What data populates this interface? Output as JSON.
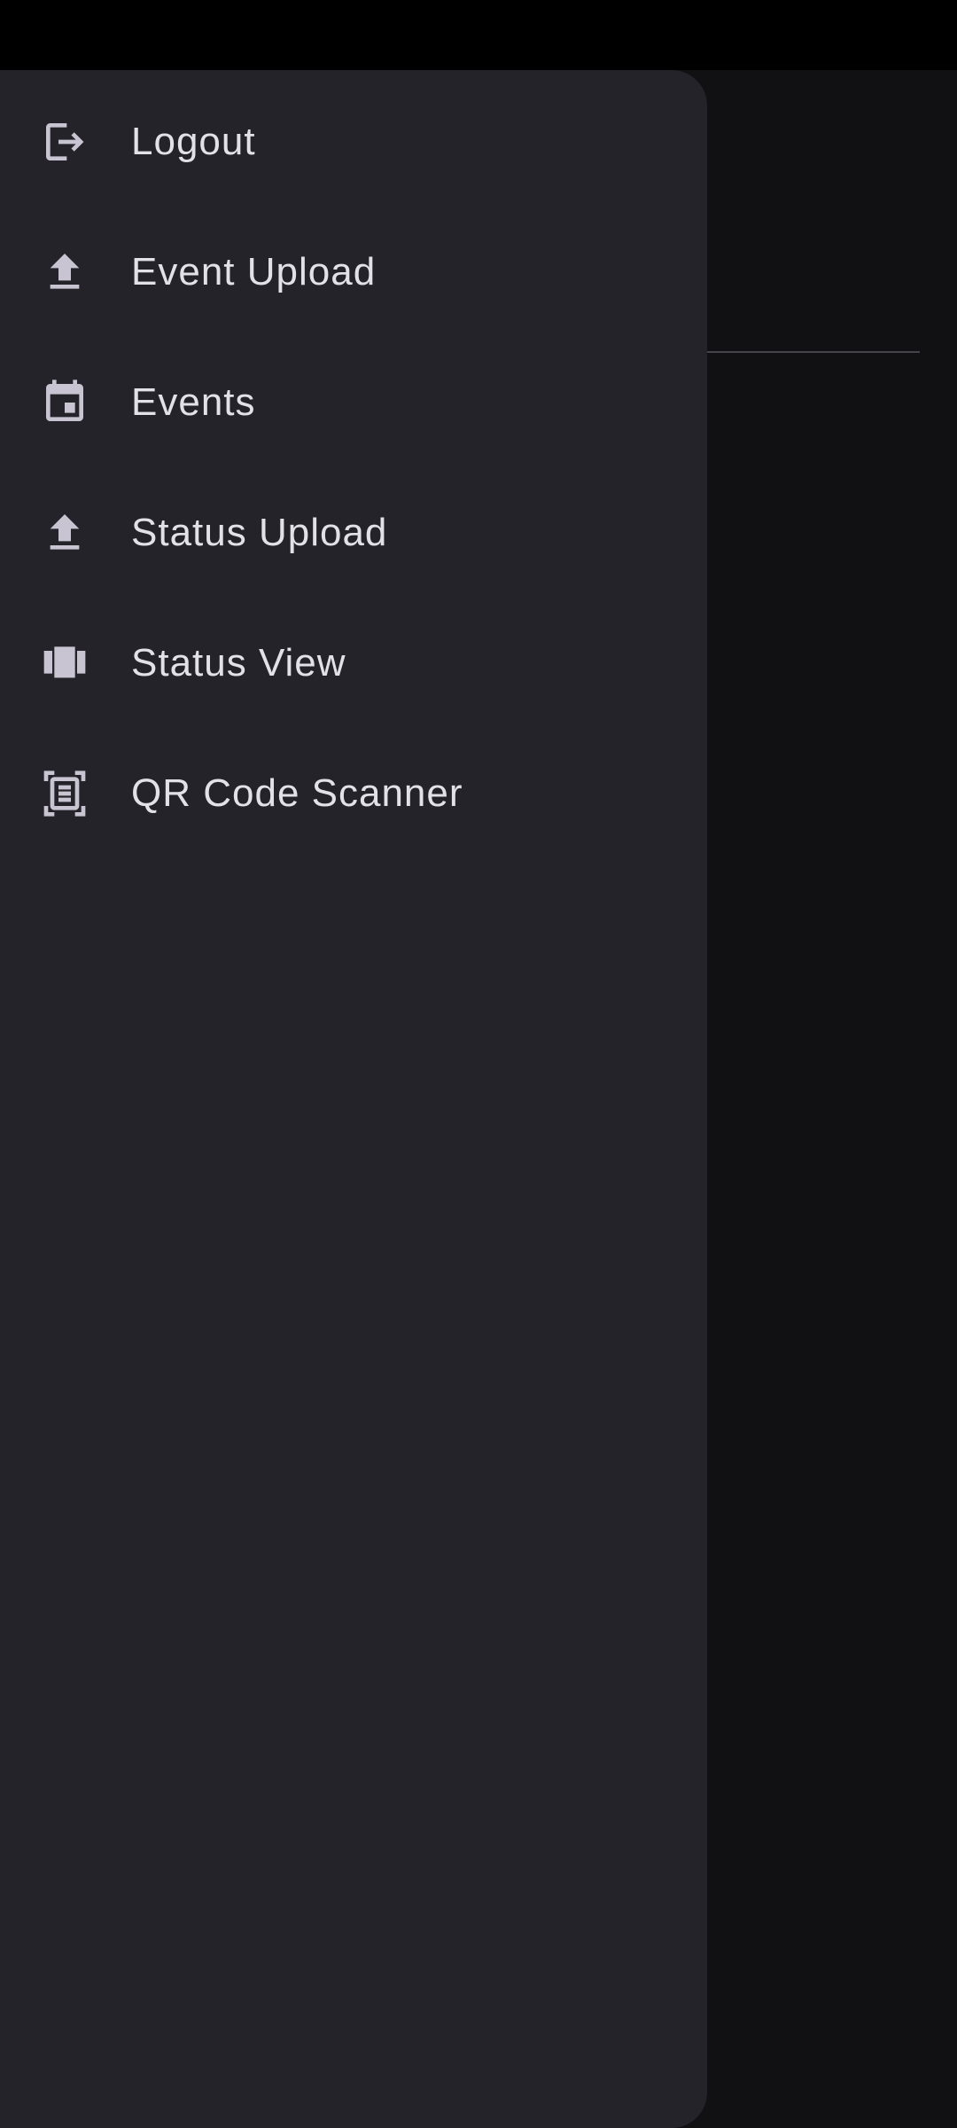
{
  "colors": {
    "status_bar": "#000000",
    "app_background": "#111113",
    "drawer_background": "#232329",
    "icon": "#c9c4d2",
    "label": "#e3e1e8"
  },
  "drawer": {
    "items": [
      {
        "label": "Logout",
        "icon": "logout-icon"
      },
      {
        "label": "Event Upload",
        "icon": "upload-icon"
      },
      {
        "label": "Events",
        "icon": "calendar-event-icon"
      },
      {
        "label": "Status Upload",
        "icon": "upload-icon"
      },
      {
        "label": "Status View",
        "icon": "view-carousel-icon"
      },
      {
        "label": "QR Code Scanner",
        "icon": "document-scanner-icon"
      }
    ]
  }
}
